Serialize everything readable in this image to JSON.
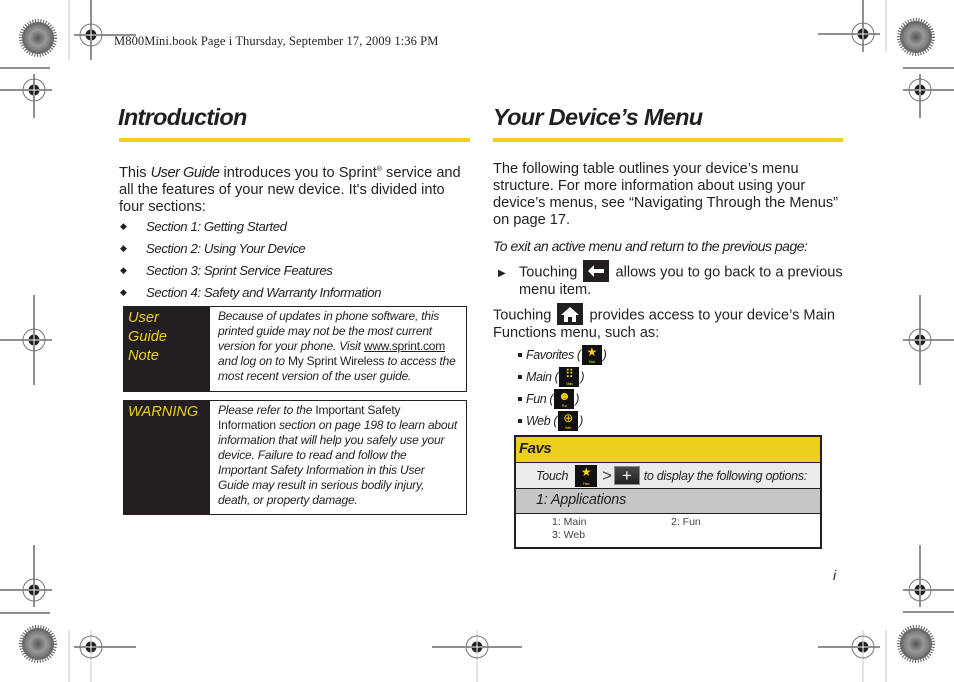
{
  "slug": "M800Mini.book  Page i  Thursday, September 17, 2009  1:36 PM",
  "left_column": {
    "title": "Introduction",
    "intro": {
      "before": "This ",
      "italic": "User Guide",
      "after": " introduces you to Sprint",
      "reg": "®",
      "rest": " service and all the features of your new device. It's divided into four sections:"
    },
    "sections": [
      "Section 1:  Getting Started",
      "Section 2:  Using Your Device",
      "Section 3:  Sprint Service Features",
      "Section 4:  Safety and Warranty Information"
    ],
    "note_box": {
      "label_lines": [
        "User",
        "Guide",
        "Note"
      ],
      "text_1": "Because of updates in phone software, this printed guide may not be the most current version for your phone. Visit ",
      "link": "www.sprint.com",
      "text_2": " and log on to ",
      "plain": "My Sprint Wireless",
      "text_3": " to access the most recent version of the user guide."
    },
    "warning_box": {
      "label": "WARNING",
      "text_1": "Please refer to the ",
      "plain": "Important Safety Information",
      "text_2": " section on page 198 to learn about information that will help you safely use your device. Failure to read and follow the Important Safety Information in this User Guide may result in serious bodily injury, death, or property damage."
    }
  },
  "right_column": {
    "title": "Your Device’s Menu",
    "intro": "The following table outlines your device’s menu structure. For more information about using your device’s menus, see “Navigating Through the Menus” on page 17.",
    "exit_heading": "To exit an active menu and return to the previous page:",
    "back_item": {
      "before": "Touching ",
      "after": " allows you to go back to a previous menu item.",
      "icon": "back-arrow-icon"
    },
    "home_para": {
      "before": "Touching ",
      "after": " provides access to your device’s Main Functions menu, such as:",
      "icon": "home-icon"
    },
    "functions": [
      {
        "label": "Favorites (",
        "icon": "star-icon",
        "glyph": "★",
        "caption": "Favs"
      },
      {
        "label": "Main (",
        "icon": "main-grid-icon",
        "glyph": "⠿",
        "caption": "Main"
      },
      {
        "label": "Fun (",
        "icon": "smiley-icon",
        "glyph": "☻",
        "caption": "Fun"
      },
      {
        "label": "Web (",
        "icon": "globe-icon",
        "glyph": "⊕",
        "caption": "Web"
      }
    ],
    "close_paren": ")",
    "favs_table": {
      "header": "Favs",
      "touch_label": "Touch",
      "star_caption": "Favs",
      "gt": ">",
      "plus": "+",
      "touch_suffix": "to display the following options:",
      "application_row": "1: Applications",
      "options": [
        "1: Main",
        "2: Fun",
        "3: Web"
      ]
    }
  },
  "page_number": "i",
  "colors": {
    "accent_yellow": "#ecd01d",
    "dark": "#231f20"
  }
}
